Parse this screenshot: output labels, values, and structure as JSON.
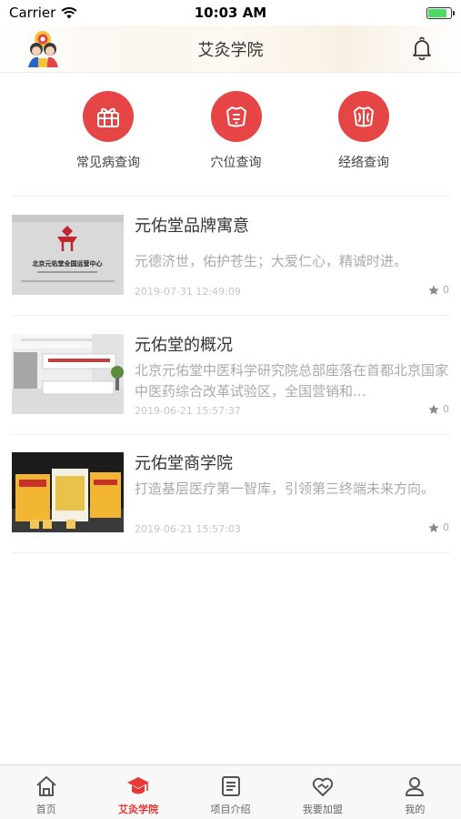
{
  "status_bar": {
    "carrier": "Carrier",
    "time": "10:03 AM"
  },
  "nav": {
    "title": "艾灸学院",
    "icons": {
      "avatar": "mascot-avatar",
      "bell": "bell-icon"
    }
  },
  "quick_entries": [
    {
      "label": "常见病查询",
      "icon": "gift-box-icon"
    },
    {
      "label": "穴位查询",
      "icon": "body-front-icon"
    },
    {
      "label": "经络查询",
      "icon": "body-back-icon"
    }
  ],
  "articles": [
    {
      "title": "元佑堂品牌寓意",
      "desc": "元德济世，佑护苍生；大爱仁心，精诚时进。",
      "date": "2019-07-31 12:49:09",
      "rating": "0",
      "thumb_text": "北京元佑堂全国运营中心"
    },
    {
      "title": "元佑堂的概况",
      "desc": "北京元佑堂中医科学研究院总部座落在首都北京国家中医药综合改革试验区，全国营销和...",
      "date": "2019-06-21 15:57:37",
      "rating": "0"
    },
    {
      "title": "元佑堂商学院",
      "desc": "打造基层医疗第一智库，引领第三终端未来方向。",
      "date": "2019-06-21 15:57:03",
      "rating": "0"
    }
  ],
  "tabs": [
    {
      "label": "首页",
      "icon": "home-icon",
      "active": false
    },
    {
      "label": "艾灸学院",
      "icon": "graduation-cap-icon",
      "active": true
    },
    {
      "label": "项目介绍",
      "icon": "document-list-icon",
      "active": false
    },
    {
      "label": "我要加盟",
      "icon": "handshake-heart-icon",
      "active": false
    },
    {
      "label": "我的",
      "icon": "user-icon",
      "active": false
    }
  ],
  "colors": {
    "accent": "#e64545",
    "tab_active": "#e53935",
    "tab_inactive": "#666666",
    "battery": "#4cd964"
  },
  "battery_level": 0.85
}
